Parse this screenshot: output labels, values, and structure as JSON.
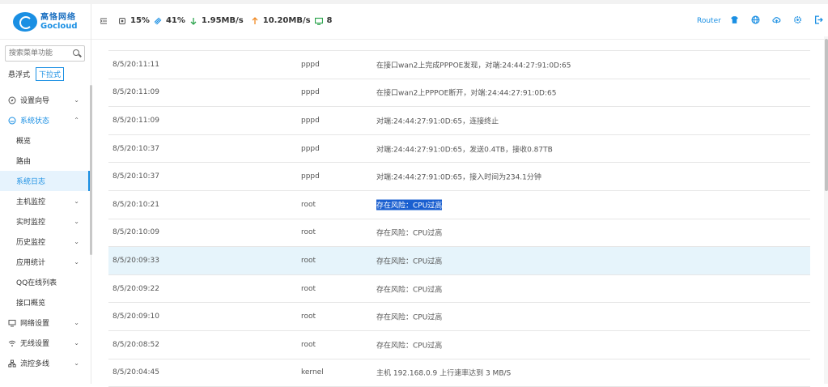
{
  "brand": {
    "name_cn": "高恪网络",
    "name_en": "Gocloud"
  },
  "sidebar": {
    "search_placeholder": "搜索菜单功能",
    "modes": [
      "悬浮式",
      "下拉式"
    ],
    "items": [
      {
        "label": "设置向导",
        "chevron": "⌄"
      },
      {
        "label": "系统状态",
        "chevron": "⌃"
      },
      {
        "label": "概览"
      },
      {
        "label": "路由"
      },
      {
        "label": "系统日志"
      },
      {
        "label": "主机监控",
        "chevron": "⌄"
      },
      {
        "label": "实时监控",
        "chevron": "⌄"
      },
      {
        "label": "历史监控",
        "chevron": "⌄"
      },
      {
        "label": "应用统计",
        "chevron": "⌄"
      },
      {
        "label": "QQ在线列表"
      },
      {
        "label": "接口概览"
      },
      {
        "label": "网络设置",
        "chevron": "⌄"
      },
      {
        "label": "无线设置",
        "chevron": "⌄"
      },
      {
        "label": "流控多线",
        "chevron": "⌄"
      }
    ]
  },
  "topbar": {
    "cpu": "15%",
    "mem": "41%",
    "down": "1.95MB/s",
    "up": "10.20MB/s",
    "devices": "8",
    "router": "Router"
  },
  "log": {
    "rows": [
      {
        "time": "8/5/20:11:11",
        "proc": "pppd",
        "msg": "在接口wan2上完成PPPOE发现，对端:24:44:27:91:0D:65"
      },
      {
        "time": "8/5/20:11:09",
        "proc": "pppd",
        "msg": "在接口wan2上PPPOE断开，对端:24:44:27:91:0D:65"
      },
      {
        "time": "8/5/20:11:09",
        "proc": "pppd",
        "msg": "对端:24:44:27:91:0D:65，连接终止"
      },
      {
        "time": "8/5/20:10:37",
        "proc": "pppd",
        "msg": "对端:24:44:27:91:0D:65，发送0.4TB，接收0.87TB"
      },
      {
        "time": "8/5/20:10:37",
        "proc": "pppd",
        "msg": "对端:24:44:27:91:0D:65，接入时间为234.1分钟"
      },
      {
        "time": "8/5/20:10:21",
        "proc": "root",
        "msg": "存在风险：CPU过高"
      },
      {
        "time": "8/5/20:10:09",
        "proc": "root",
        "msg": "存在风险：CPU过高"
      },
      {
        "time": "8/5/20:09:33",
        "proc": "root",
        "msg": "存在风险：CPU过高"
      },
      {
        "time": "8/5/20:09:22",
        "proc": "root",
        "msg": "存在风险：CPU过高"
      },
      {
        "time": "8/5/20:09:10",
        "proc": "root",
        "msg": "存在风险：CPU过高"
      },
      {
        "time": "8/5/20:08:52",
        "proc": "root",
        "msg": "存在风险：CPU过高"
      },
      {
        "time": "8/5/20:04:45",
        "proc": "kernel",
        "msg": "主机 192.168.0.9 上行速率达到 3 MB/S"
      }
    ]
  },
  "colors": {
    "accent": "#1a8fe3",
    "highlight_row": "#e6f4fb",
    "selection": "#1a5fd0"
  }
}
